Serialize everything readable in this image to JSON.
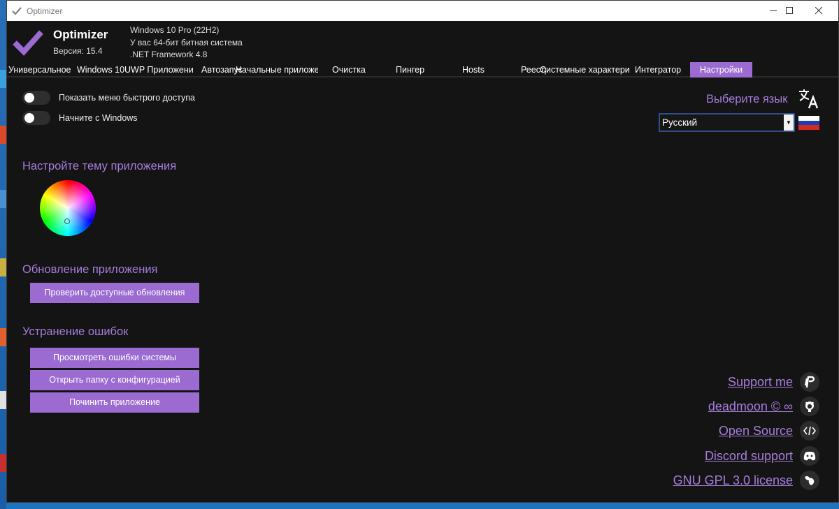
{
  "window": {
    "title": "Optimizer"
  },
  "header": {
    "app_name": "Optimizer",
    "version": "Версия: 15.4",
    "sysinfo": [
      "Windows 10 Pro (22H2)",
      "У вас 64-бит битная система",
      ".NET Framework 4.8"
    ]
  },
  "tabs": [
    "Универсальное",
    "Windows 10",
    "UWP Приложени",
    "Автозапуск",
    "Начальные приложе",
    "Очистка",
    "Пингер",
    "Hosts",
    "Реестр",
    "Системные характери",
    "Интегратор",
    "Настройки"
  ],
  "active_tab": "Настройки",
  "settings": {
    "toggles": [
      {
        "label": "Показать меню быстрого доступа",
        "on": false
      },
      {
        "label": "Начните с Windows",
        "on": false
      }
    ],
    "theme_title": "Настройте тему приложения",
    "update_title": "Обновление приложения",
    "update_button": "Проверить доступные обновления",
    "troubleshoot_title": "Устранение ошибок",
    "troubleshoot_buttons": [
      "Просмотреть ошибки системы",
      "Открыть папку с конфигурацией",
      "Починить приложение"
    ],
    "language_title": "Выберите язык",
    "language_value": "Русский"
  },
  "links": [
    {
      "label": "Support me",
      "icon": "paypal-icon"
    },
    {
      "label": "deadmoon © ∞",
      "icon": "github-icon"
    },
    {
      "label": "Open Source",
      "icon": "code-icon"
    },
    {
      "label": "Discord support",
      "icon": "discord-icon"
    },
    {
      "label": "GNU GPL 3.0 license",
      "icon": "gnu-icon"
    }
  ],
  "colors": {
    "accent": "#9b6bd1",
    "accent_text": "#a67ddb",
    "background": "#141414"
  }
}
